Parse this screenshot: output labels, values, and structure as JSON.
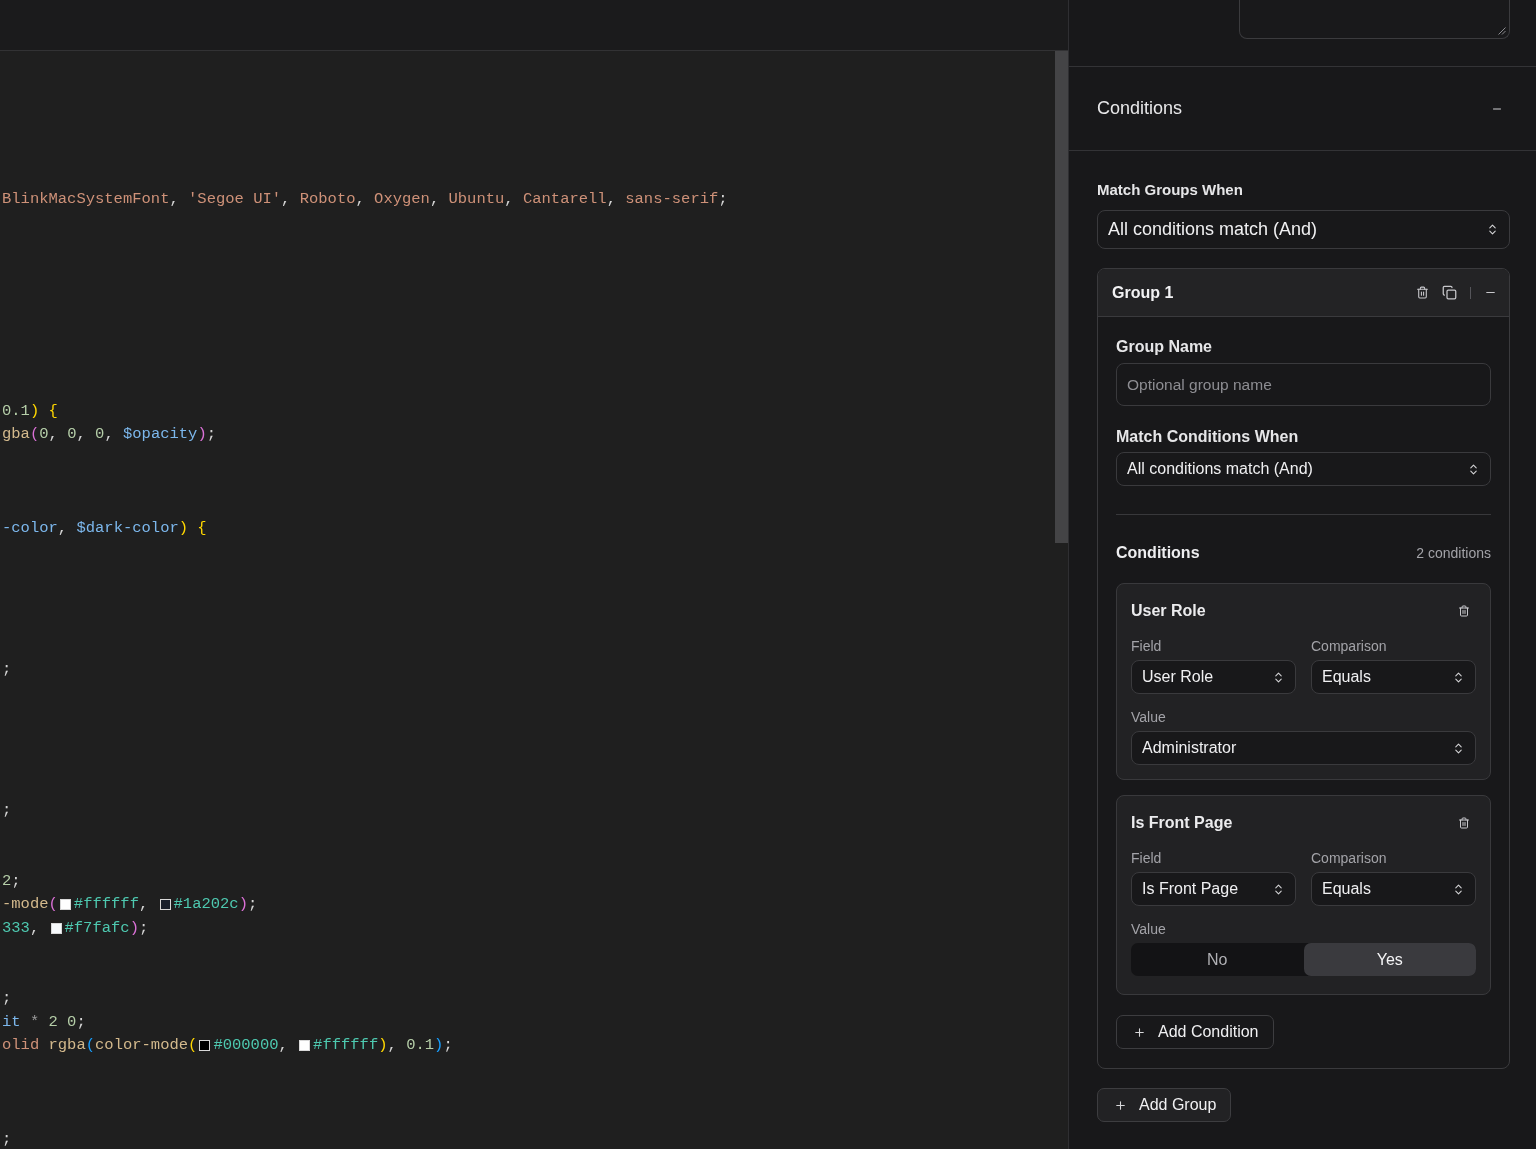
{
  "editor": {
    "lines": [
      {
        "kind": "code",
        "segments": [
          {
            "kind": "string",
            "text": "BlinkMacSystemFont"
          },
          {
            "kind": "plain",
            "text": ", "
          },
          {
            "kind": "string",
            "text": "'Segoe UI'"
          },
          {
            "kind": "plain",
            "text": ", "
          },
          {
            "kind": "string",
            "text": "Roboto"
          },
          {
            "kind": "plain",
            "text": ", "
          },
          {
            "kind": "string",
            "text": "Oxygen"
          },
          {
            "kind": "plain",
            "text": ", "
          },
          {
            "kind": "string",
            "text": "Ubuntu"
          },
          {
            "kind": "plain",
            "text": ", "
          },
          {
            "kind": "string",
            "text": "Cantarell"
          },
          {
            "kind": "plain",
            "text": ", "
          },
          {
            "kind": "string",
            "text": "sans-serif"
          },
          {
            "kind": "plain",
            "text": ";"
          }
        ]
      },
      {
        "kind": "blank"
      },
      {
        "kind": "blank"
      },
      {
        "kind": "blank"
      },
      {
        "kind": "blank"
      },
      {
        "kind": "blank"
      },
      {
        "kind": "blank"
      },
      {
        "kind": "blank"
      },
      {
        "kind": "blank"
      },
      {
        "kind": "code",
        "segments": [
          {
            "kind": "number",
            "text": "0.1"
          },
          {
            "kind": "bracket1",
            "text": ")"
          },
          {
            "kind": "bracket1",
            "text": " {"
          }
        ]
      },
      {
        "kind": "code",
        "segments": [
          {
            "kind": "func",
            "text": "gba"
          },
          {
            "kind": "bracket2",
            "text": "("
          },
          {
            "kind": "number",
            "text": "0"
          },
          {
            "kind": "plain",
            "text": ", "
          },
          {
            "kind": "number",
            "text": "0"
          },
          {
            "kind": "plain",
            "text": ", "
          },
          {
            "kind": "number",
            "text": "0"
          },
          {
            "kind": "plain",
            "text": ", "
          },
          {
            "kind": "variable",
            "text": "$opacity"
          },
          {
            "kind": "bracket2",
            "text": ")"
          },
          {
            "kind": "plain",
            "text": ";"
          }
        ]
      },
      {
        "kind": "blank"
      },
      {
        "kind": "blank"
      },
      {
        "kind": "blank"
      },
      {
        "kind": "code",
        "segments": [
          {
            "kind": "variable",
            "text": "-color"
          },
          {
            "kind": "plain",
            "text": ", "
          },
          {
            "kind": "variable",
            "text": "$dark-color"
          },
          {
            "kind": "bracket1",
            "text": ")"
          },
          {
            "kind": "bracket1",
            "text": " {"
          }
        ]
      },
      {
        "kind": "blank"
      },
      {
        "kind": "blank"
      },
      {
        "kind": "blank"
      },
      {
        "kind": "blank"
      },
      {
        "kind": "blank"
      },
      {
        "kind": "code",
        "segments": [
          {
            "kind": "plain",
            "text": ";"
          }
        ]
      },
      {
        "kind": "blank"
      },
      {
        "kind": "blank"
      },
      {
        "kind": "blank"
      },
      {
        "kind": "blank"
      },
      {
        "kind": "blank"
      },
      {
        "kind": "code",
        "segments": [
          {
            "kind": "plain",
            "text": ";"
          }
        ]
      },
      {
        "kind": "blank"
      },
      {
        "kind": "blank"
      },
      {
        "kind": "code",
        "segments": [
          {
            "kind": "number",
            "text": "2"
          },
          {
            "kind": "plain",
            "text": ";"
          }
        ]
      },
      {
        "kind": "code",
        "segments": [
          {
            "kind": "func",
            "text": "-mode"
          },
          {
            "kind": "bracket2",
            "text": "("
          },
          {
            "kind": "swatch",
            "color": "#ffffff"
          },
          {
            "kind": "hex",
            "text": "#ffffff"
          },
          {
            "kind": "plain",
            "text": ", "
          },
          {
            "kind": "swatch",
            "color": "#1a202c"
          },
          {
            "kind": "hex",
            "text": "#1a202c"
          },
          {
            "kind": "bracket2",
            "text": ")"
          },
          {
            "kind": "plain",
            "text": ";"
          }
        ]
      },
      {
        "kind": "code",
        "segments": [
          {
            "kind": "hex",
            "text": "333"
          },
          {
            "kind": "plain",
            "text": ", "
          },
          {
            "kind": "swatch",
            "color": "#f7fafc"
          },
          {
            "kind": "hex",
            "text": "#f7fafc"
          },
          {
            "kind": "bracket2",
            "text": ")"
          },
          {
            "kind": "plain",
            "text": ";"
          }
        ]
      },
      {
        "kind": "blank"
      },
      {
        "kind": "blank"
      },
      {
        "kind": "code",
        "segments": [
          {
            "kind": "plain",
            "text": ";"
          }
        ]
      },
      {
        "kind": "code",
        "segments": [
          {
            "kind": "variable",
            "text": "it"
          },
          {
            "kind": "operator",
            "text": " * "
          },
          {
            "kind": "number",
            "text": "2 0"
          },
          {
            "kind": "plain",
            "text": ";"
          }
        ]
      },
      {
        "kind": "code",
        "segments": [
          {
            "kind": "string",
            "text": "olid "
          },
          {
            "kind": "func",
            "text": "rgba"
          },
          {
            "kind": "bracket3",
            "text": "("
          },
          {
            "kind": "func",
            "text": "color-mode"
          },
          {
            "kind": "bracket1",
            "text": "("
          },
          {
            "kind": "swatch",
            "color": "#000000"
          },
          {
            "kind": "hex",
            "text": "#000000"
          },
          {
            "kind": "plain",
            "text": ", "
          },
          {
            "kind": "swatch",
            "color": "#ffffff"
          },
          {
            "kind": "hex",
            "text": "#ffffff"
          },
          {
            "kind": "bracket1",
            "text": ")"
          },
          {
            "kind": "plain",
            "text": ", "
          },
          {
            "kind": "number",
            "text": "0.1"
          },
          {
            "kind": "bracket3",
            "text": ")"
          },
          {
            "kind": "plain",
            "text": ";"
          }
        ]
      },
      {
        "kind": "blank"
      },
      {
        "kind": "blank"
      },
      {
        "kind": "blank"
      },
      {
        "kind": "code",
        "segments": [
          {
            "kind": "plain",
            "text": ";"
          }
        ]
      }
    ]
  },
  "panel": {
    "section": {
      "title": "Conditions",
      "expanded": true
    },
    "match_groups": {
      "label": "Match Groups When",
      "value": "All conditions match (And)"
    },
    "groups": [
      {
        "title": "Group 1",
        "expanded": true,
        "name_field": {
          "label": "Group Name",
          "placeholder": "Optional group name"
        },
        "match_conditions": {
          "label": "Match Conditions When",
          "value": "All conditions match (And)"
        },
        "conditions_heading": "Conditions",
        "conditions_count": "2 conditions",
        "conditions": [
          {
            "title": "User Role",
            "field": {
              "label": "Field",
              "value": "User Role"
            },
            "comparison": {
              "label": "Comparison",
              "value": "Equals"
            },
            "value": {
              "label": "Value",
              "kind": "select",
              "text": "Administrator"
            }
          },
          {
            "title": "Is Front Page",
            "field": {
              "label": "Field",
              "value": "Is Front Page"
            },
            "comparison": {
              "label": "Comparison",
              "value": "Equals"
            },
            "value": {
              "label": "Value",
              "kind": "toggle",
              "options": [
                {
                  "label": "No",
                  "selected": false
                },
                {
                  "label": "Yes",
                  "selected": true
                }
              ]
            }
          }
        ],
        "add_condition": "Add Condition"
      }
    ],
    "add_group": "Add Group"
  }
}
